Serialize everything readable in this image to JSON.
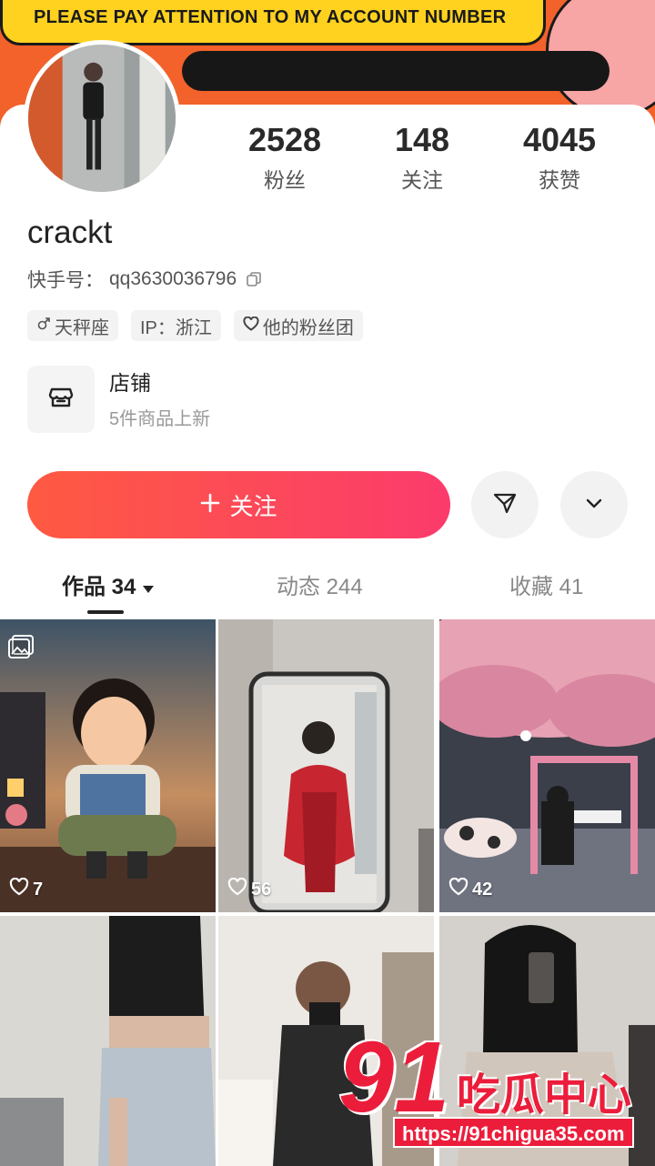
{
  "banner": {
    "text": "PLEASE PAY ATTENTION TO MY ACCOUNT NUMBER"
  },
  "profile": {
    "username": "crackt",
    "account_label": "快手号：",
    "account_id": "qq3630036796",
    "stats": [
      {
        "value": "2528",
        "label": "粉丝"
      },
      {
        "value": "148",
        "label": "关注"
      },
      {
        "value": "4045",
        "label": "获赞"
      }
    ],
    "tags": {
      "zodiac": "天秤座",
      "ip": "IP：浙江",
      "fan_group": "他的粉丝团"
    }
  },
  "shop": {
    "title": "店铺",
    "subtitle": "5件商品上新"
  },
  "actions": {
    "follow_label": "关注"
  },
  "tabs": [
    {
      "label": "作品 34"
    },
    {
      "label": "动态 244"
    },
    {
      "label": "收藏 41"
    }
  ],
  "posts": [
    {
      "likes": "7"
    },
    {
      "likes": "56"
    },
    {
      "likes": "42"
    }
  ],
  "watermark": {
    "number": "91",
    "brand": "吃瓜中心",
    "url": "https://91chigua35.com"
  },
  "colors": {
    "accent_start": "#fe5a42",
    "accent_end": "#fb3b6c",
    "banner_orange": "#f2622a",
    "banner_yellow": "#ffd21f"
  }
}
